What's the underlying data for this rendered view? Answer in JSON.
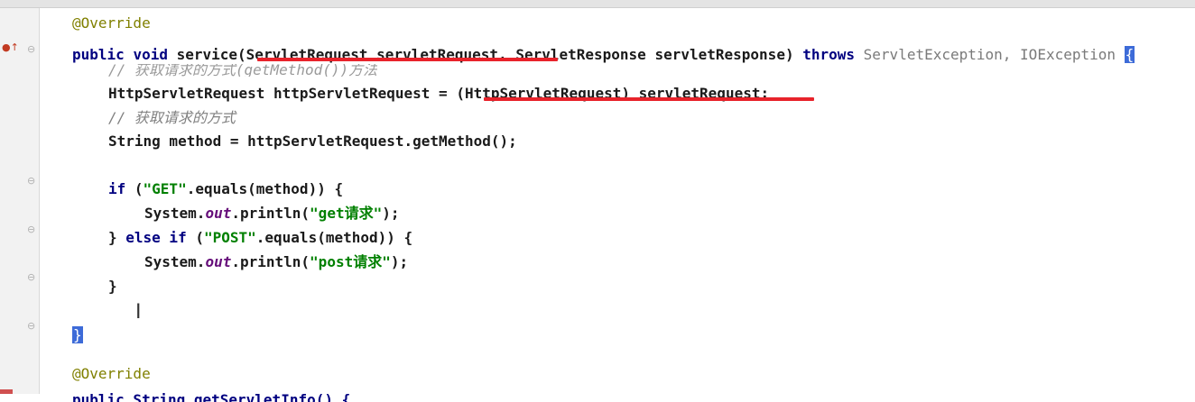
{
  "code": {
    "line1": "@Override",
    "line2_public": "public",
    "line2_void": "void",
    "line2_service": "service(",
    "line2_p1type": "ServletRequest",
    "line2_p1name": "servletRequest,",
    "line2_p2type": "ServletResponse",
    "line2_p2name": "servletResponse)",
    "line2_throws": "throws",
    "line2_ex": "ServletException, IOException",
    "line2_brace": "{",
    "line3_partial": "// 获取请求的方式(getMethod())方法",
    "line4_type": "HttpServletRequest",
    "line4_rest": "httpServletRequest = ",
    "line4_cast": "(HttpServletRequest) servletRequest;",
    "line5_comment": "// 获取请求的方式",
    "line6": "String method = httpServletRequest.getMethod();",
    "line8_if": "if",
    "line8_open": " (",
    "line8_str": "\"GET\"",
    "line8_rest": ".equals(method)) {",
    "line9_sys": "System.",
    "line9_out": "out",
    "line9_print": ".println(",
    "line9_str": "\"get请求\"",
    "line9_end": ");",
    "line10_close": "} ",
    "line10_else": "else if",
    "line10_open": " (",
    "line10_str": "\"POST\"",
    "line10_rest": ".equals(method)) {",
    "line11_sys": "System.",
    "line11_out": "out",
    "line11_print": ".println(",
    "line11_str": "\"post请求\"",
    "line11_end": ");",
    "line12": "}",
    "line14_brace": "}",
    "line15": "@Override",
    "line16_partial": "public String getServletInfo() {"
  },
  "colors": {
    "keyword": "#000080",
    "annotation": "#808000",
    "string": "#008000",
    "comment": "#808080",
    "highlight_underline": "#e8232b",
    "current_line": "#fdfbe6"
  },
  "icons": [
    "breakpoint-icon",
    "fold-marker-icon",
    "text-cursor-icon"
  ]
}
